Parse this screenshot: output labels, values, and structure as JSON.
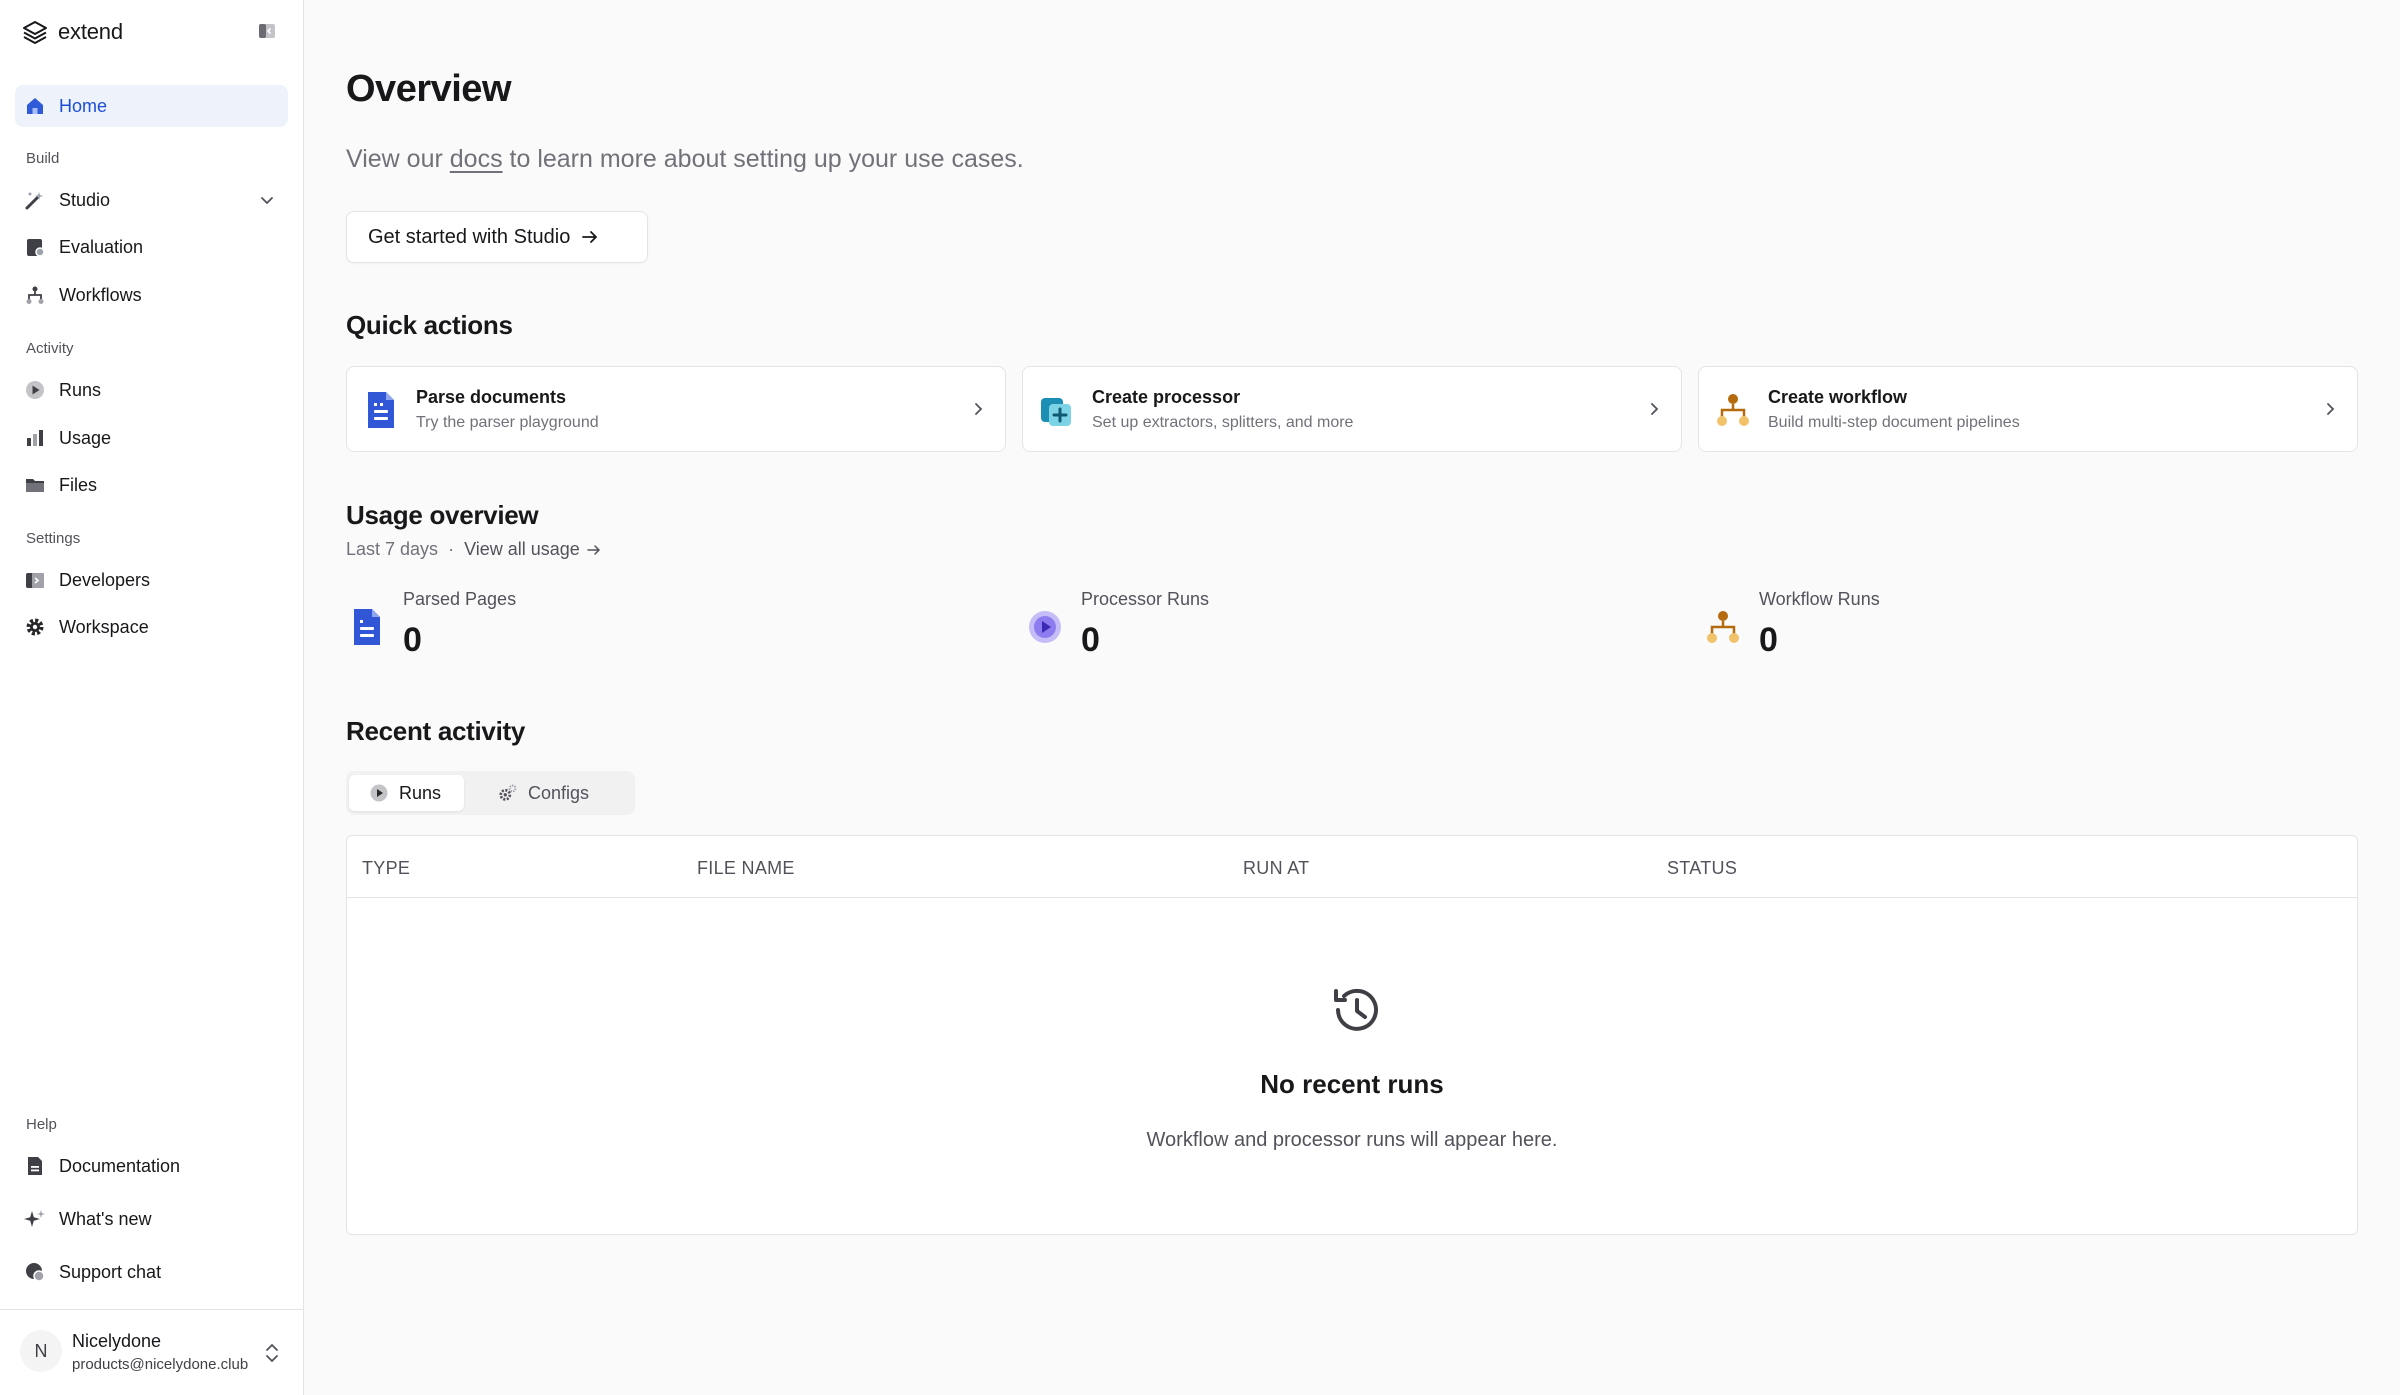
{
  "brand": {
    "name": "extend"
  },
  "sidebar": {
    "home": "Home",
    "sections": {
      "build": "Build",
      "activity": "Activity",
      "settings": "Settings",
      "help": "Help"
    },
    "build_items": [
      "Studio",
      "Evaluation",
      "Workflows"
    ],
    "activity_items": [
      "Runs",
      "Usage",
      "Files"
    ],
    "settings_items": [
      "Developers",
      "Workspace"
    ],
    "help_items": [
      "Documentation",
      "What's new",
      "Support chat"
    ]
  },
  "user": {
    "initial": "N",
    "name": "Nicelydone",
    "email": "products@nicelydone.club"
  },
  "main": {
    "title": "Overview",
    "intro_prefix": "View our ",
    "intro_link": "docs",
    "intro_suffix": " to learn more about setting up your use cases.",
    "studio_button": "Get started with Studio",
    "quick_actions_heading": "Quick actions",
    "quick_actions": [
      {
        "title": "Parse documents",
        "subtitle": "Try the parser playground",
        "icon": "document-icon"
      },
      {
        "title": "Create processor",
        "subtitle": "Set up extractors, splitters, and more",
        "icon": "processor-add-icon"
      },
      {
        "title": "Create workflow",
        "subtitle": "Build multi-step document pipelines",
        "icon": "workflow-icon"
      }
    ],
    "usage_heading": "Usage overview",
    "usage_period": "Last 7 days",
    "usage_separator": "·",
    "usage_link": "View all usage",
    "stats": [
      {
        "label": "Parsed Pages",
        "value": "0"
      },
      {
        "label": "Processor Runs",
        "value": "0"
      },
      {
        "label": "Workflow Runs",
        "value": "0"
      }
    ],
    "recent_heading": "Recent activity",
    "tabs": {
      "runs": "Runs",
      "configs": "Configs"
    },
    "table": {
      "columns": [
        "TYPE",
        "FILE NAME",
        "RUN AT",
        "STATUS"
      ],
      "empty_title": "No recent runs",
      "empty_subtitle": "Workflow and processor runs will appear here."
    }
  },
  "colors": {
    "accent_blue": "#1d4ed8",
    "active_bg": "#eef2fb",
    "workflow_orange": "#e5a33b",
    "processor_purple": "#6d5ce7"
  }
}
